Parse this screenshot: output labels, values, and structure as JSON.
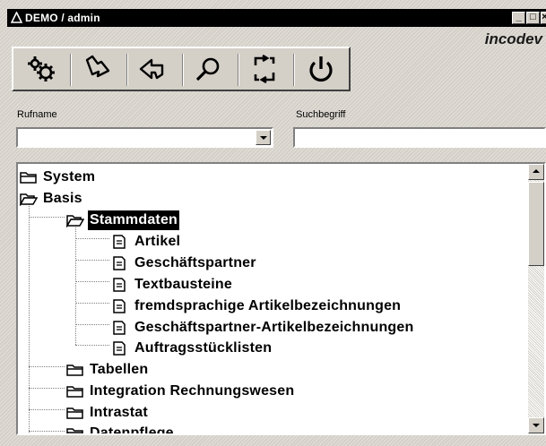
{
  "window": {
    "title": "DEMO / admin",
    "minimize_label": "_",
    "maximize_label": "□",
    "close_label": "×"
  },
  "brand": "incodev",
  "toolbar": {
    "buttons": [
      {
        "name": "settings",
        "icon": "gears-icon"
      },
      {
        "name": "forward",
        "icon": "forward-arrow-icon"
      },
      {
        "name": "back",
        "icon": "back-arrow-icon"
      },
      {
        "name": "search",
        "icon": "magnifier-icon"
      },
      {
        "name": "refresh",
        "icon": "swap-arrows-icon"
      },
      {
        "name": "power",
        "icon": "power-icon"
      }
    ]
  },
  "fields": {
    "rufname_label": "Rufname",
    "rufname_value": "",
    "suchbegriff_label": "Suchbegriff",
    "suchbegriff_value": ""
  },
  "tree": {
    "items": [
      {
        "label": "System",
        "type": "folder-closed"
      },
      {
        "label": "Basis",
        "type": "folder-open"
      },
      {
        "label": "Stammdaten",
        "type": "folder-open",
        "selected": true
      },
      {
        "label": "Artikel",
        "type": "document"
      },
      {
        "label": "Geschäftspartner",
        "type": "document"
      },
      {
        "label": "Textbausteine",
        "type": "document"
      },
      {
        "label": "fremdsprachige Artikelbezeichnungen",
        "type": "document"
      },
      {
        "label": "Geschäftspartner-Artikelbezeichnungen",
        "type": "document"
      },
      {
        "label": "Auftragsstücklisten",
        "type": "document"
      },
      {
        "label": "Tabellen",
        "type": "folder-closed"
      },
      {
        "label": "Integration Rechnungswesen",
        "type": "folder-closed"
      },
      {
        "label": "Intrastat",
        "type": "folder-closed"
      },
      {
        "label": "Datenpflege",
        "type": "folder-closed"
      }
    ]
  }
}
